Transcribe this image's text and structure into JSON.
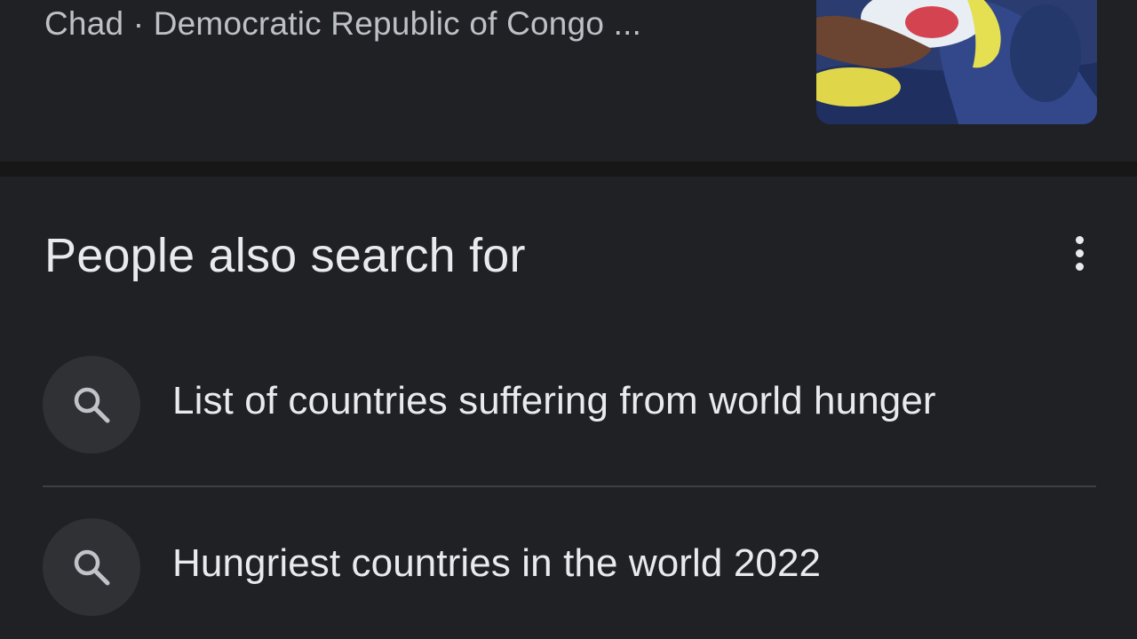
{
  "top_result": {
    "snippet": "Chad · Democratic Republic of Congo ..."
  },
  "people_also_search_for": {
    "title": "People also search for",
    "items": [
      {
        "label": "List of countries suffering from world hunger",
        "icon": "search-icon"
      },
      {
        "label": "Hungriest countries in the world 2022",
        "icon": "search-icon"
      }
    ]
  },
  "colors": {
    "background": "#202124",
    "separator": "#171717",
    "primary_text": "#e8eaed",
    "secondary_text": "#bdc1c6",
    "icon_circle": "#303134"
  }
}
